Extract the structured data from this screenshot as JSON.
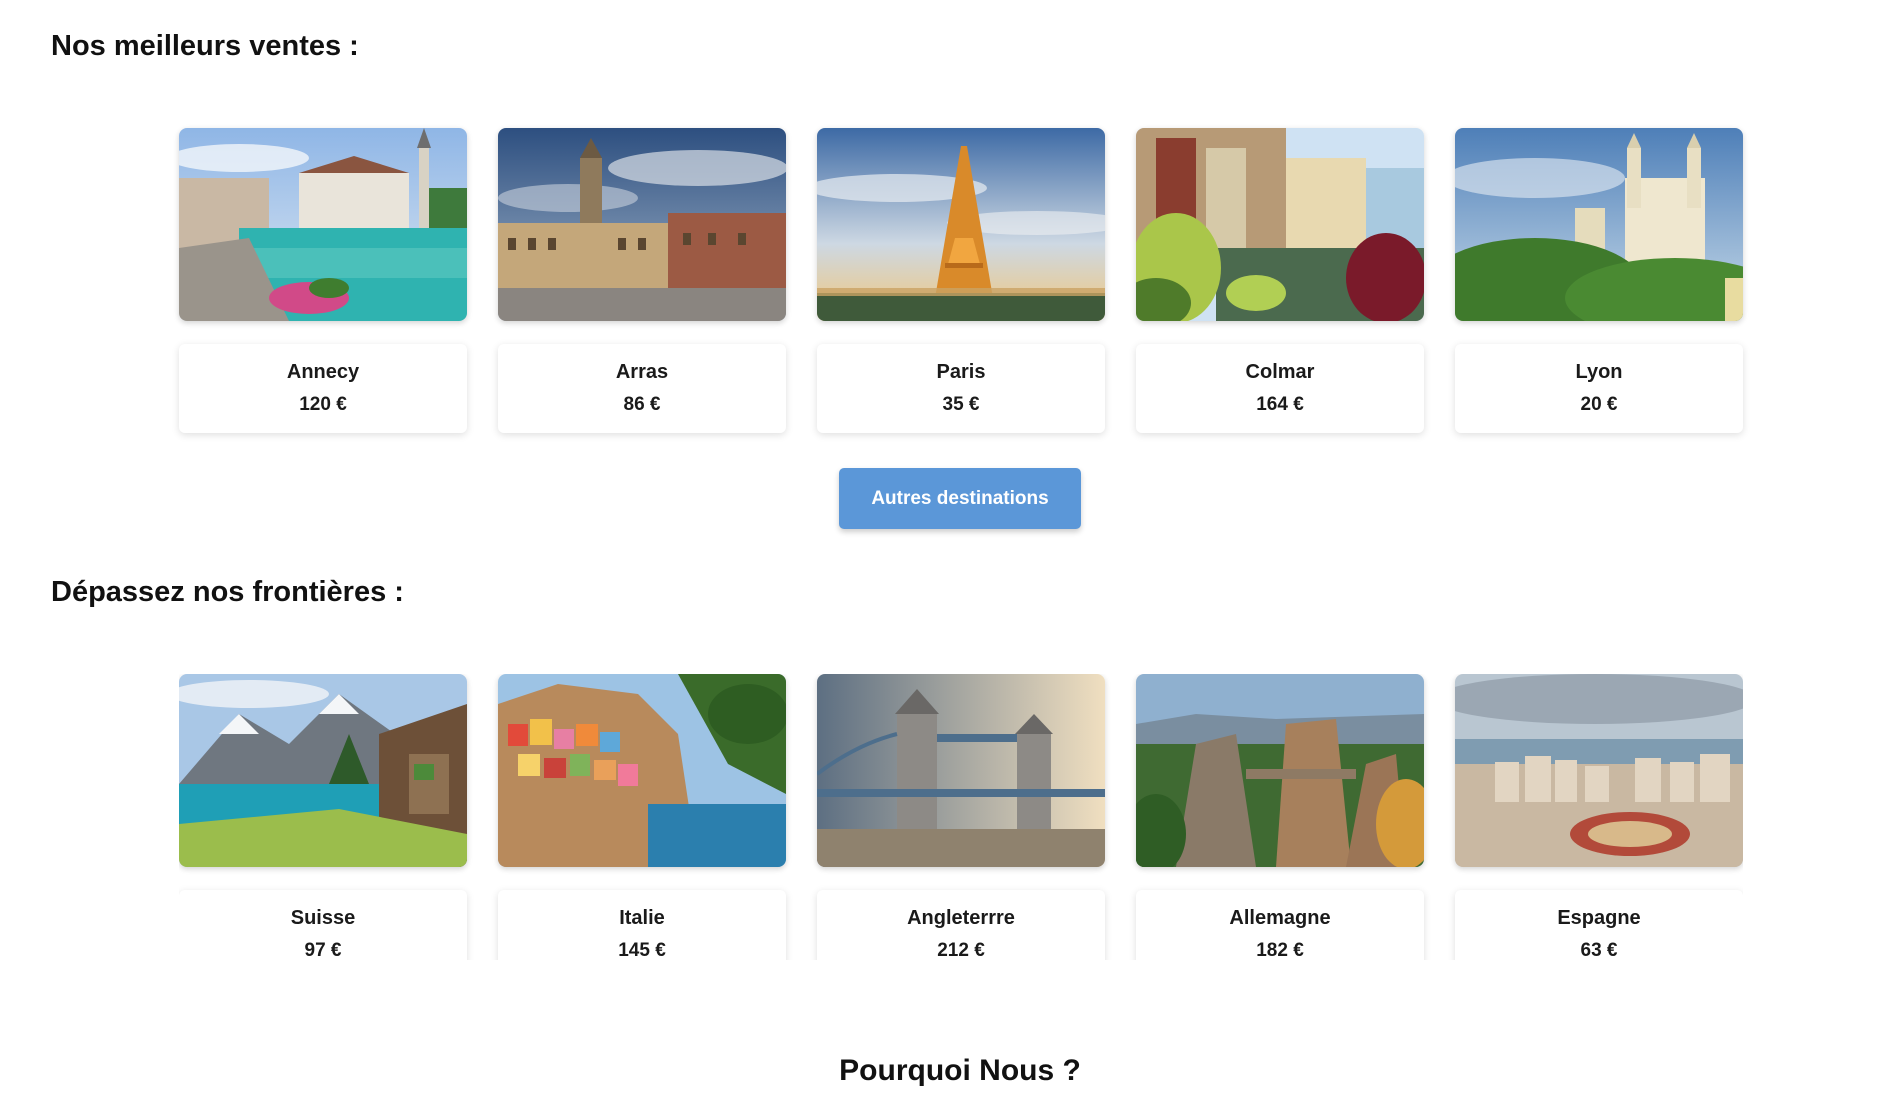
{
  "sections": {
    "bestsellers_title": "Nos meilleurs ventes :",
    "abroad_title": "Dépassez nos frontières :",
    "why_title": "Pourquoi Nous ?"
  },
  "bestsellers": [
    {
      "name": "Annecy",
      "price": "120 €",
      "image": "annecy-canal-photo"
    },
    {
      "name": "Arras",
      "price": "86 €",
      "image": "arras-square-photo"
    },
    {
      "name": "Paris",
      "price": "35 €",
      "image": "paris-eiffel-tower-photo"
    },
    {
      "name": "Colmar",
      "price": "164 €",
      "image": "colmar-canal-photo"
    },
    {
      "name": "Lyon",
      "price": "20 €",
      "image": "lyon-fourviere-photo"
    }
  ],
  "more_button": "Autres destinations",
  "abroad": [
    {
      "name": "Suisse",
      "price": "97 €",
      "image": "swiss-lake-mountains-photo"
    },
    {
      "name": "Italie",
      "price": "145 €",
      "image": "cinque-terre-photo"
    },
    {
      "name": "Angleterrre",
      "price": "212 €",
      "image": "tower-bridge-photo"
    },
    {
      "name": "Allemagne",
      "price": "182 €",
      "image": "bastei-bridge-photo"
    },
    {
      "name": "Espagne",
      "price": "63 €",
      "image": "malaga-bullring-photo"
    }
  ]
}
